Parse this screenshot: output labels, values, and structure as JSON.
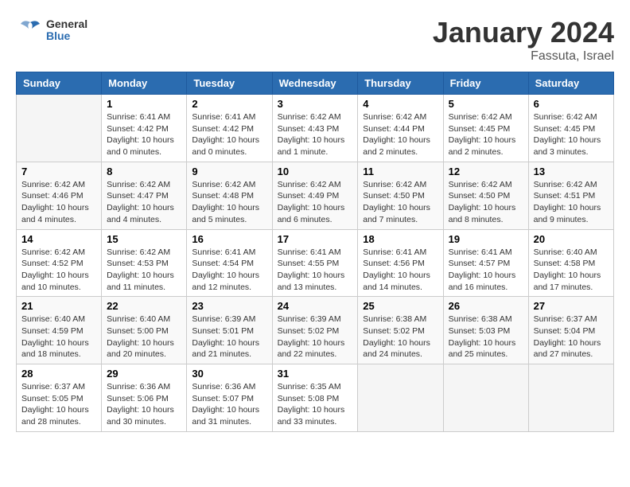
{
  "logo": {
    "text_general": "General",
    "text_blue": "Blue"
  },
  "header": {
    "month": "January 2024",
    "location": "Fassuta, Israel"
  },
  "weekdays": [
    "Sunday",
    "Monday",
    "Tuesday",
    "Wednesday",
    "Thursday",
    "Friday",
    "Saturday"
  ],
  "weeks": [
    [
      {
        "day": "",
        "sunrise": "",
        "sunset": "",
        "daylight": ""
      },
      {
        "day": "1",
        "sunrise": "Sunrise: 6:41 AM",
        "sunset": "Sunset: 4:42 PM",
        "daylight": "Daylight: 10 hours and 0 minutes."
      },
      {
        "day": "2",
        "sunrise": "Sunrise: 6:41 AM",
        "sunset": "Sunset: 4:42 PM",
        "daylight": "Daylight: 10 hours and 0 minutes."
      },
      {
        "day": "3",
        "sunrise": "Sunrise: 6:42 AM",
        "sunset": "Sunset: 4:43 PM",
        "daylight": "Daylight: 10 hours and 1 minute."
      },
      {
        "day": "4",
        "sunrise": "Sunrise: 6:42 AM",
        "sunset": "Sunset: 4:44 PM",
        "daylight": "Daylight: 10 hours and 2 minutes."
      },
      {
        "day": "5",
        "sunrise": "Sunrise: 6:42 AM",
        "sunset": "Sunset: 4:45 PM",
        "daylight": "Daylight: 10 hours and 2 minutes."
      },
      {
        "day": "6",
        "sunrise": "Sunrise: 6:42 AM",
        "sunset": "Sunset: 4:45 PM",
        "daylight": "Daylight: 10 hours and 3 minutes."
      }
    ],
    [
      {
        "day": "7",
        "sunrise": "Sunrise: 6:42 AM",
        "sunset": "Sunset: 4:46 PM",
        "daylight": "Daylight: 10 hours and 4 minutes."
      },
      {
        "day": "8",
        "sunrise": "Sunrise: 6:42 AM",
        "sunset": "Sunset: 4:47 PM",
        "daylight": "Daylight: 10 hours and 4 minutes."
      },
      {
        "day": "9",
        "sunrise": "Sunrise: 6:42 AM",
        "sunset": "Sunset: 4:48 PM",
        "daylight": "Daylight: 10 hours and 5 minutes."
      },
      {
        "day": "10",
        "sunrise": "Sunrise: 6:42 AM",
        "sunset": "Sunset: 4:49 PM",
        "daylight": "Daylight: 10 hours and 6 minutes."
      },
      {
        "day": "11",
        "sunrise": "Sunrise: 6:42 AM",
        "sunset": "Sunset: 4:50 PM",
        "daylight": "Daylight: 10 hours and 7 minutes."
      },
      {
        "day": "12",
        "sunrise": "Sunrise: 6:42 AM",
        "sunset": "Sunset: 4:50 PM",
        "daylight": "Daylight: 10 hours and 8 minutes."
      },
      {
        "day": "13",
        "sunrise": "Sunrise: 6:42 AM",
        "sunset": "Sunset: 4:51 PM",
        "daylight": "Daylight: 10 hours and 9 minutes."
      }
    ],
    [
      {
        "day": "14",
        "sunrise": "Sunrise: 6:42 AM",
        "sunset": "Sunset: 4:52 PM",
        "daylight": "Daylight: 10 hours and 10 minutes."
      },
      {
        "day": "15",
        "sunrise": "Sunrise: 6:42 AM",
        "sunset": "Sunset: 4:53 PM",
        "daylight": "Daylight: 10 hours and 11 minutes."
      },
      {
        "day": "16",
        "sunrise": "Sunrise: 6:41 AM",
        "sunset": "Sunset: 4:54 PM",
        "daylight": "Daylight: 10 hours and 12 minutes."
      },
      {
        "day": "17",
        "sunrise": "Sunrise: 6:41 AM",
        "sunset": "Sunset: 4:55 PM",
        "daylight": "Daylight: 10 hours and 13 minutes."
      },
      {
        "day": "18",
        "sunrise": "Sunrise: 6:41 AM",
        "sunset": "Sunset: 4:56 PM",
        "daylight": "Daylight: 10 hours and 14 minutes."
      },
      {
        "day": "19",
        "sunrise": "Sunrise: 6:41 AM",
        "sunset": "Sunset: 4:57 PM",
        "daylight": "Daylight: 10 hours and 16 minutes."
      },
      {
        "day": "20",
        "sunrise": "Sunrise: 6:40 AM",
        "sunset": "Sunset: 4:58 PM",
        "daylight": "Daylight: 10 hours and 17 minutes."
      }
    ],
    [
      {
        "day": "21",
        "sunrise": "Sunrise: 6:40 AM",
        "sunset": "Sunset: 4:59 PM",
        "daylight": "Daylight: 10 hours and 18 minutes."
      },
      {
        "day": "22",
        "sunrise": "Sunrise: 6:40 AM",
        "sunset": "Sunset: 5:00 PM",
        "daylight": "Daylight: 10 hours and 20 minutes."
      },
      {
        "day": "23",
        "sunrise": "Sunrise: 6:39 AM",
        "sunset": "Sunset: 5:01 PM",
        "daylight": "Daylight: 10 hours and 21 minutes."
      },
      {
        "day": "24",
        "sunrise": "Sunrise: 6:39 AM",
        "sunset": "Sunset: 5:02 PM",
        "daylight": "Daylight: 10 hours and 22 minutes."
      },
      {
        "day": "25",
        "sunrise": "Sunrise: 6:38 AM",
        "sunset": "Sunset: 5:02 PM",
        "daylight": "Daylight: 10 hours and 24 minutes."
      },
      {
        "day": "26",
        "sunrise": "Sunrise: 6:38 AM",
        "sunset": "Sunset: 5:03 PM",
        "daylight": "Daylight: 10 hours and 25 minutes."
      },
      {
        "day": "27",
        "sunrise": "Sunrise: 6:37 AM",
        "sunset": "Sunset: 5:04 PM",
        "daylight": "Daylight: 10 hours and 27 minutes."
      }
    ],
    [
      {
        "day": "28",
        "sunrise": "Sunrise: 6:37 AM",
        "sunset": "Sunset: 5:05 PM",
        "daylight": "Daylight: 10 hours and 28 minutes."
      },
      {
        "day": "29",
        "sunrise": "Sunrise: 6:36 AM",
        "sunset": "Sunset: 5:06 PM",
        "daylight": "Daylight: 10 hours and 30 minutes."
      },
      {
        "day": "30",
        "sunrise": "Sunrise: 6:36 AM",
        "sunset": "Sunset: 5:07 PM",
        "daylight": "Daylight: 10 hours and 31 minutes."
      },
      {
        "day": "31",
        "sunrise": "Sunrise: 6:35 AM",
        "sunset": "Sunset: 5:08 PM",
        "daylight": "Daylight: 10 hours and 33 minutes."
      },
      {
        "day": "",
        "sunrise": "",
        "sunset": "",
        "daylight": ""
      },
      {
        "day": "",
        "sunrise": "",
        "sunset": "",
        "daylight": ""
      },
      {
        "day": "",
        "sunrise": "",
        "sunset": "",
        "daylight": ""
      }
    ]
  ]
}
